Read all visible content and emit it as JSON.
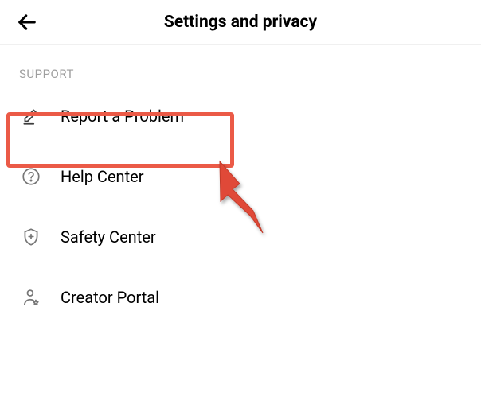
{
  "header": {
    "title": "Settings and privacy"
  },
  "section": {
    "label": "SUPPORT"
  },
  "menu": {
    "items": [
      {
        "icon": "pencil-icon",
        "label": "Report a Problem"
      },
      {
        "icon": "question-icon",
        "label": "Help Center"
      },
      {
        "icon": "shield-icon",
        "label": "Safety Center"
      },
      {
        "icon": "person-icon",
        "label": "Creator Portal"
      }
    ]
  },
  "annotation": {
    "highlight_color": "#eb5a47"
  }
}
